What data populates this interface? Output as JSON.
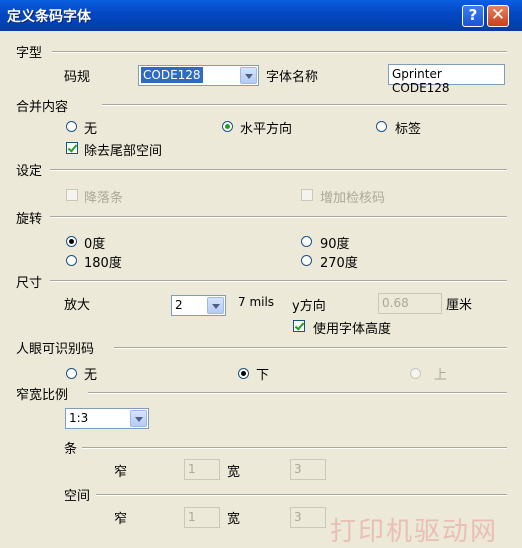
{
  "window": {
    "title": "定义条码字体",
    "help_label": "?",
    "close_label": "✕"
  },
  "type_section": {
    "label": "字型",
    "code_label": "码规",
    "code_value": "CODE128",
    "font_name_label": "字体名称",
    "font_name_value": "Gprinter CODE128"
  },
  "merge_section": {
    "label": "合并内容",
    "options": [
      "无",
      "水平方向",
      "标签"
    ],
    "selected": "水平方向",
    "trim_label": "除去尾部空间",
    "trim_checked": true
  },
  "settings_section": {
    "label": "设定",
    "option1": "降落条",
    "option2": "增加检核码"
  },
  "rotation_section": {
    "label": "旋转",
    "options": [
      "0度",
      "90度",
      "180度",
      "270度"
    ],
    "selected": "0度"
  },
  "size_section": {
    "label": "尺寸",
    "scale_label": "放大",
    "scale_value": "2",
    "mils_label": "7 mils",
    "ydir_label": "y方向",
    "ydir_value": "0.68",
    "unit_label": "厘米",
    "use_font_height_label": "使用字体高度",
    "use_font_height_checked": true
  },
  "human_section": {
    "label": "人眼可识别码",
    "options": [
      "无",
      "下",
      "上"
    ],
    "selected": "下"
  },
  "ratio_section": {
    "label": "窄宽比例",
    "ratio_value": "1:3",
    "bar_label": "条",
    "bar_narrow_label": "窄",
    "bar_narrow_value": "1",
    "bar_wide_label": "宽",
    "bar_wide_value": "3",
    "space_label": "空间",
    "space_narrow_label": "窄",
    "space_narrow_value": "1",
    "space_wide_label": "宽",
    "space_wide_value": "3"
  },
  "watermark": "打印机驱动网"
}
